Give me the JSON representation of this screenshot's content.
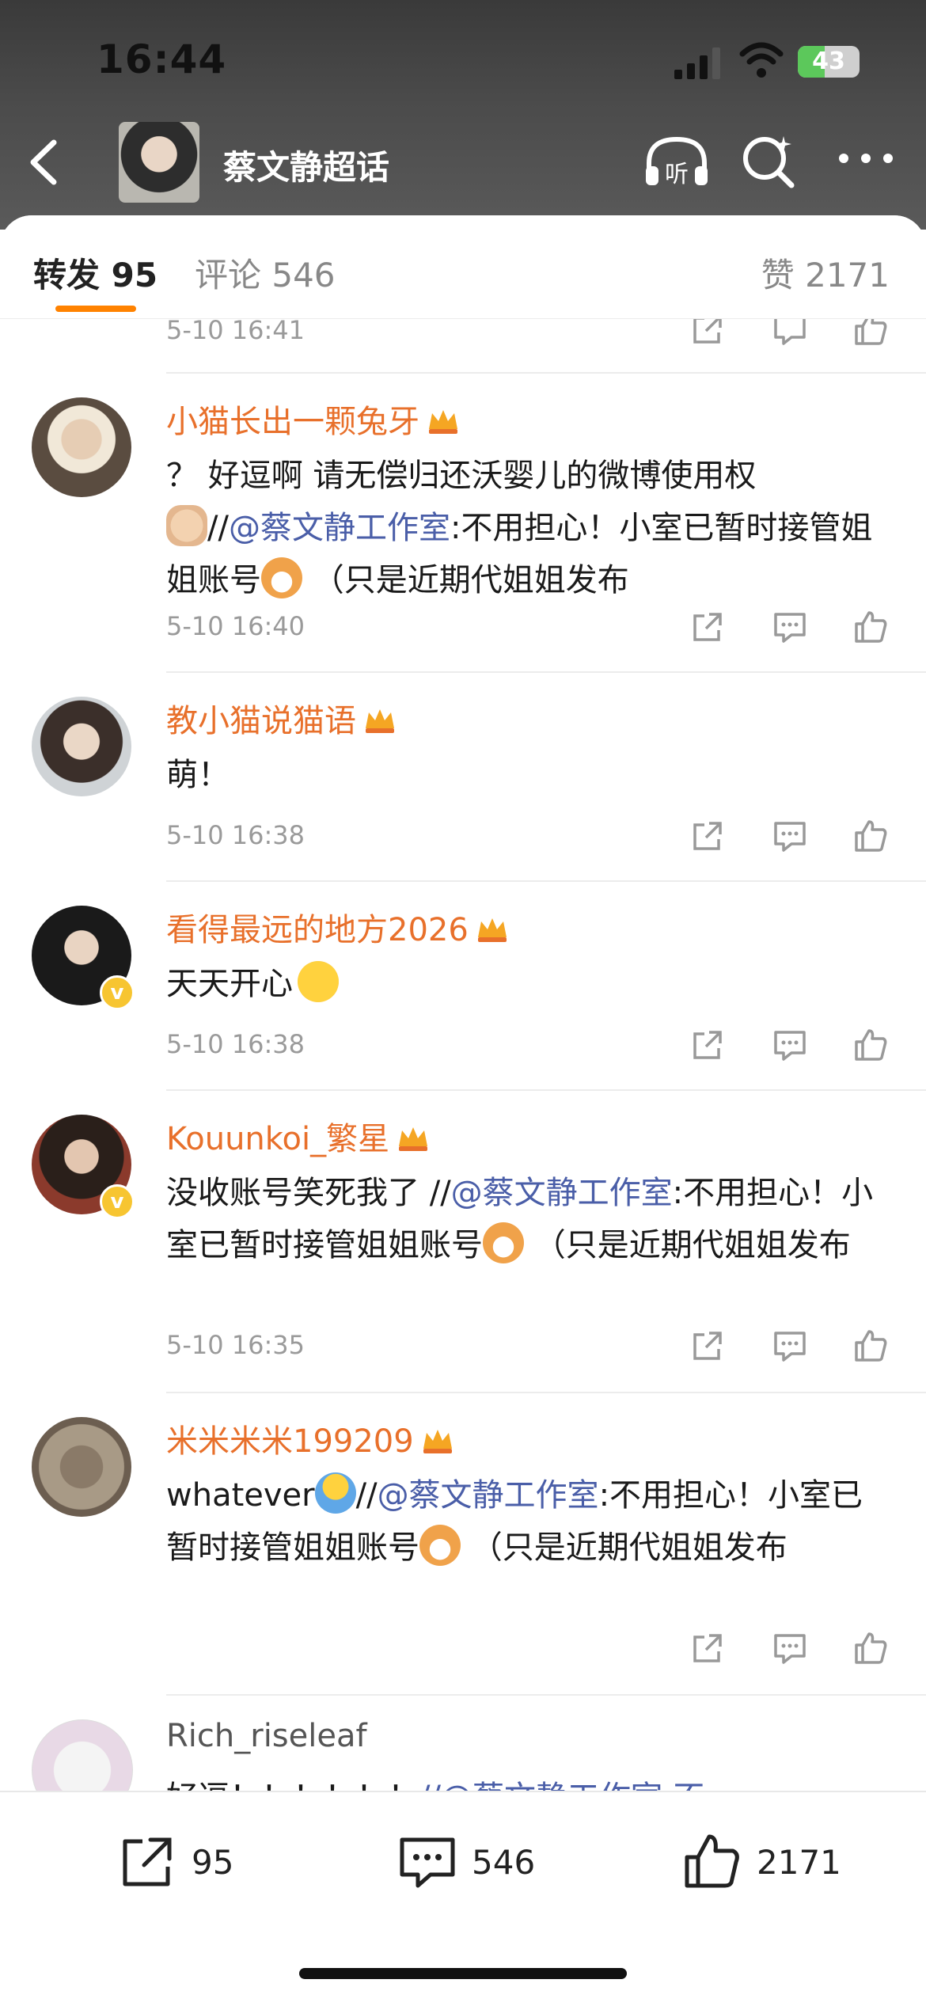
{
  "status_bar": {
    "time": "16:44",
    "battery": "43",
    "battery_level": 0.43
  },
  "header": {
    "title": "蔡文静超话",
    "avatar": "topic-avatar",
    "icons": [
      "back-icon",
      "headphones-listen-icon",
      "search-icon",
      "more-icon"
    ]
  },
  "tabs": {
    "repost": "转发 95",
    "comment": "评论 546",
    "like": "赞 2171"
  },
  "top_partial_time": "5-10 16:41",
  "reposts": [
    {
      "user": "小猫长出一颗兔牙",
      "text_parts": [
        "？ 好逗啊 请无偿归还沃婴儿的微博使用权",
        "//",
        "@蔡文静工作室",
        ":不用担心！小室已暂时接管姐姐账号",
        " （只是近期代姐姐发布"
      ],
      "time": "5-10 16:40",
      "verified": false
    },
    {
      "user": "教小猫说猫语",
      "text_parts": [
        "萌！"
      ],
      "time": "5-10 16:38",
      "verified": false
    },
    {
      "user": "看得最远的地方2026",
      "text_parts": [
        "天天开心"
      ],
      "time": "5-10 16:38",
      "verified": true
    },
    {
      "user": "Kouunkoi_繁星",
      "text_parts": [
        "没收账号笑死我了 //",
        "@蔡文静工作室",
        ":不用担心！小室已暂时接管姐姐账号",
        " （只是近期代姐姐发布"
      ],
      "time": "5-10 16:35",
      "verified": true
    },
    {
      "user": "米米米米199209",
      "text_parts": [
        "whatever",
        "//",
        "@蔡文静工作室",
        ":不用担心！小室已暂时接管姐姐账号",
        " （只是近期代姐姐发布"
      ],
      "time": "",
      "verified": false
    },
    {
      "user": "Rich_riseleaf",
      "text_parts": [
        "好逗！！！！！！",
        "//@蔡文静工作室:不"
      ],
      "time": "",
      "verified": false
    }
  ],
  "bottom_bar": {
    "repost_count": "95",
    "comment_count": "546",
    "like_count": "2171"
  },
  "colors": {
    "accent": "#ff8200",
    "username": "#e8702b",
    "link": "#4a5ea8"
  }
}
